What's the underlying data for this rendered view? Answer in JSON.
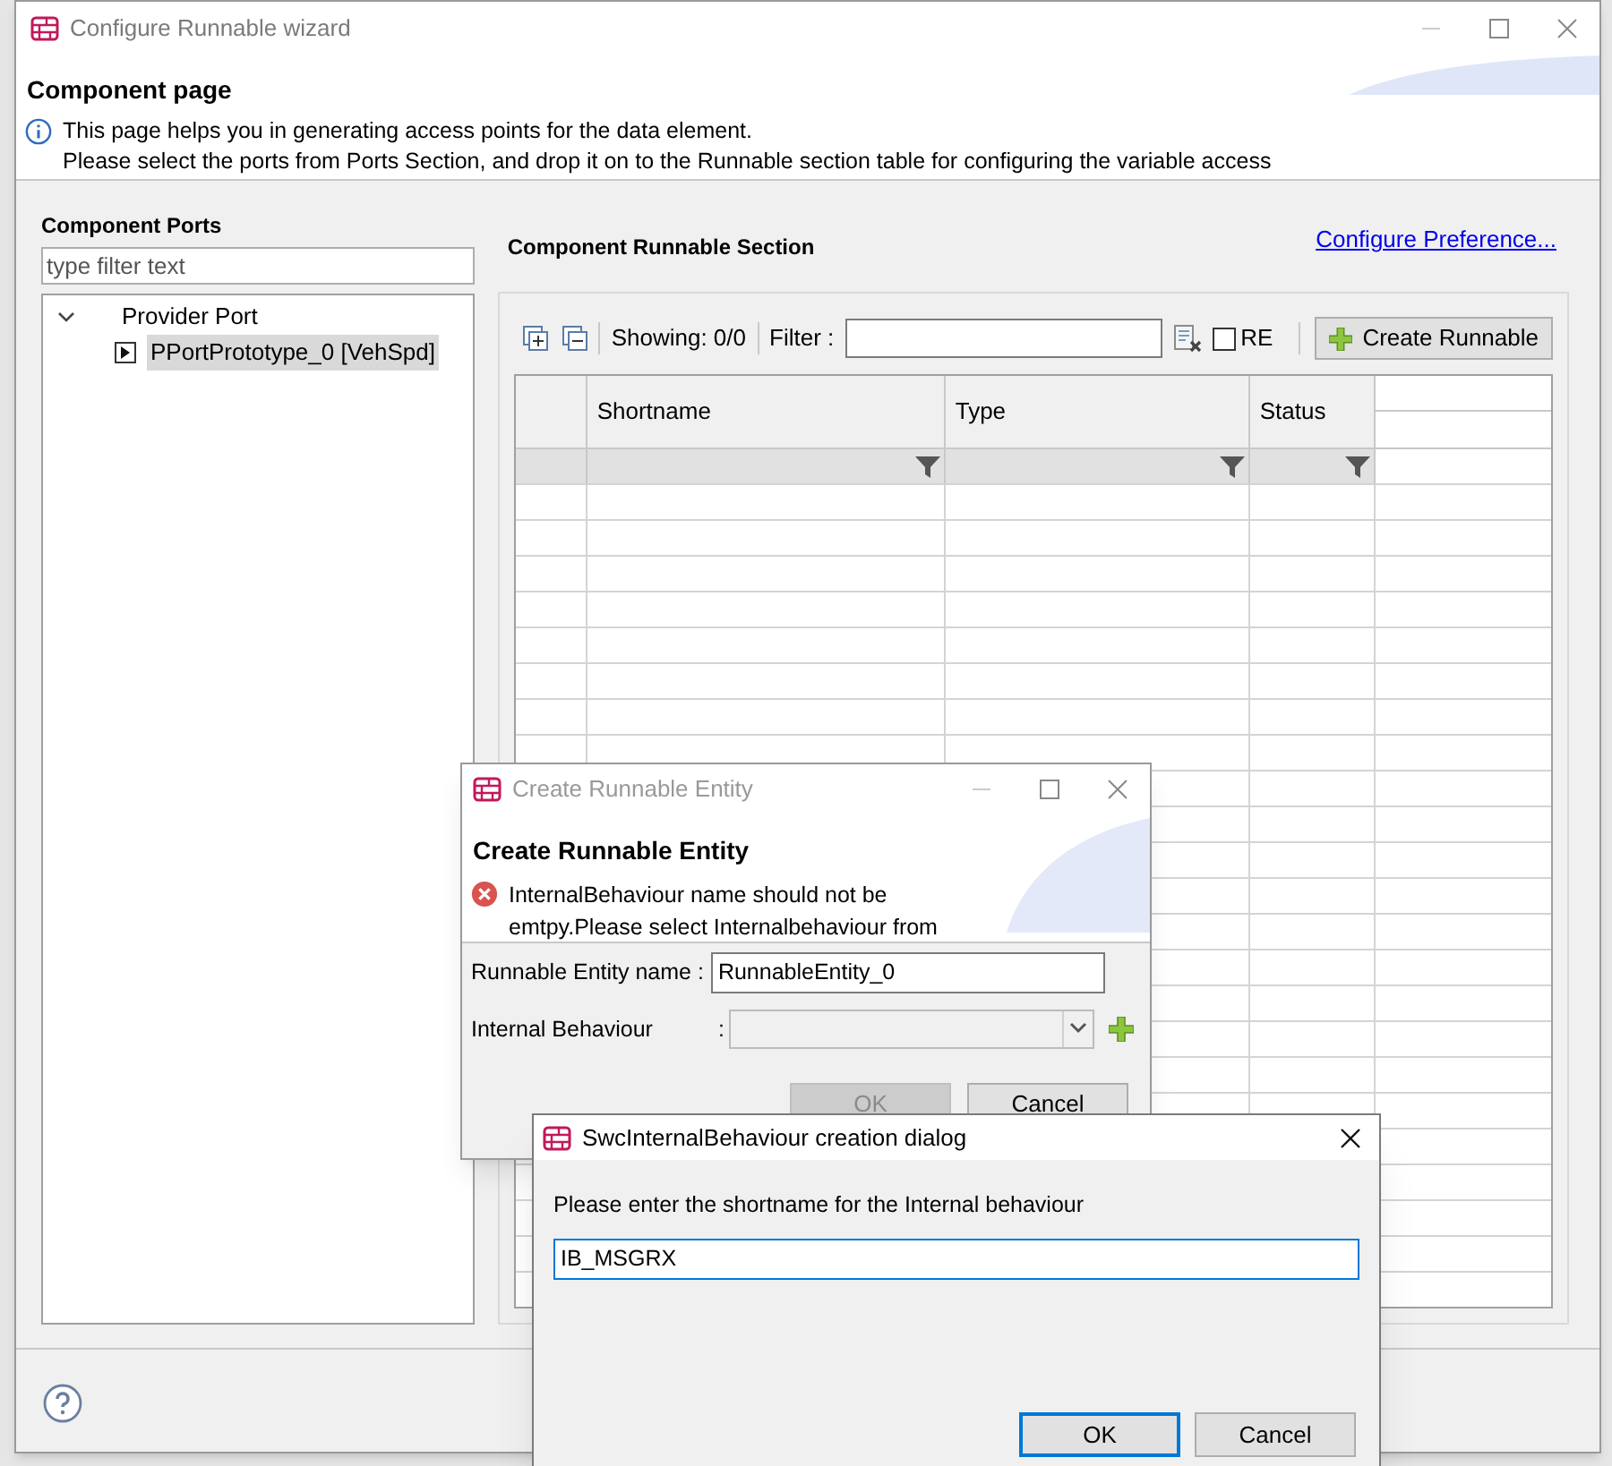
{
  "wizard": {
    "title": "Configure Runnable wizard",
    "page_title": "Component page",
    "info_lines": [
      "This page helps you in generating access points for the data element.",
      "Please select the ports from Ports Section, and drop it on to the Runnable section table for configuring the variable access"
    ]
  },
  "ports": {
    "heading": "Component Ports",
    "filter_placeholder": "type filter text",
    "tree": [
      {
        "label": "Provider Port",
        "expanded": true,
        "children": [
          {
            "label": "PPortPrototype_0 [VehSpd]",
            "selected": true
          }
        ]
      }
    ]
  },
  "runnables": {
    "heading": "Component Runnable Section",
    "link": "Configure Preference...",
    "showing": "Showing: 0/0",
    "filter_label": "Filter :",
    "re_label": "RE",
    "re_checked": false,
    "create_button": "Create Runnable",
    "columns": [
      "Shortname",
      "Type",
      "Status"
    ]
  },
  "entity_dialog": {
    "title": "Create Runnable Entity",
    "heading": "Create Runnable Entity",
    "error": "InternalBehaviour name should not be emtpy.Please select Internalbehaviour from",
    "name_label": "Runnable Entity name :",
    "name_value": "RunnableEntity_0",
    "behaviour_label": "Internal Behaviour",
    "behaviour_separator": ":",
    "ok": "OK",
    "ok_disabled": true,
    "cancel": "Cancel"
  },
  "ib_dialog": {
    "title": "SwcInternalBehaviour creation dialog",
    "prompt": "Please enter the shortname for the Internal behaviour",
    "value": "IB_MSGRX",
    "ok": "OK",
    "cancel": "Cancel"
  }
}
